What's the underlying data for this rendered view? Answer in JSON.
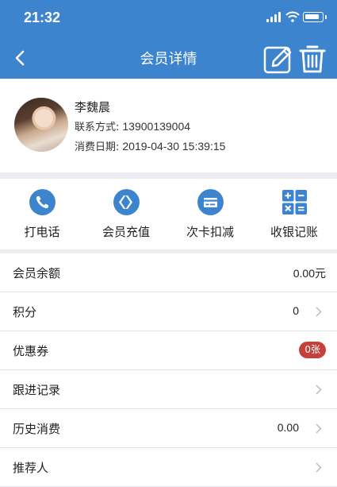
{
  "status_bar": {
    "time": "21:32"
  },
  "header": {
    "title": "会员详情"
  },
  "member": {
    "name": "李魏晨",
    "contact_label": "联系方式:",
    "contact_value": "13900139004",
    "date_label": "消费日期:",
    "date_value": "2019-04-30 15:39:15"
  },
  "actions": [
    {
      "label": "打电话",
      "icon": "phone-icon"
    },
    {
      "label": "会员充值",
      "icon": "recharge-icon"
    },
    {
      "label": "次卡扣减",
      "icon": "card-deduct-icon"
    },
    {
      "label": "收银记账",
      "icon": "calculator-icon"
    }
  ],
  "rows": [
    {
      "label": "会员余额",
      "value": "0.00元"
    },
    {
      "label": "积分",
      "value": "0"
    },
    {
      "label": "优惠券",
      "value": "0张"
    },
    {
      "label": "跟进记录",
      "value": ""
    },
    {
      "label": "历史消费",
      "value": "0.00"
    },
    {
      "label": "推荐人",
      "value": ""
    }
  ],
  "colors": {
    "primary": "#3d84cf",
    "badge": "#c6403a",
    "background": "#ececf0"
  }
}
